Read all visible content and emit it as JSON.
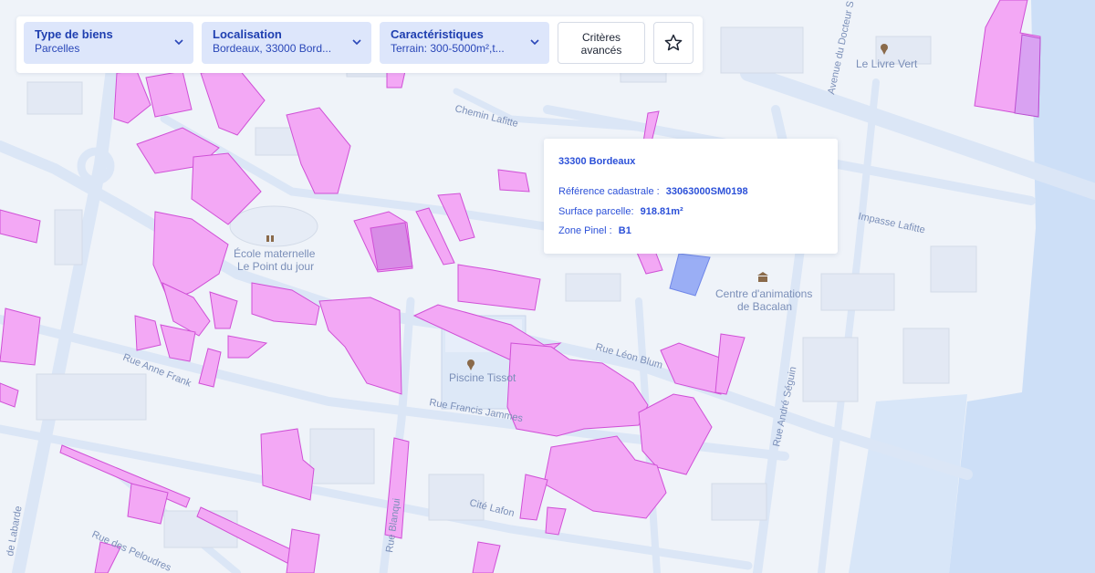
{
  "toolbar": {
    "filters": [
      {
        "title": "Type de biens",
        "value": "Parcelles"
      },
      {
        "title": "Localisation",
        "value": "Bordeaux, 33000 Bord..."
      },
      {
        "title": "Caractéristiques",
        "value": "Terrain: 300-5000m²,t..."
      }
    ],
    "advanced_label_line1": "Critères",
    "advanced_label_line2": "avancés"
  },
  "popup": {
    "title": "33300 Bordeaux",
    "ref_label": "Référence cadastrale :",
    "ref_value": "33063000SM0198",
    "surface_label": "Surface parcelle:",
    "surface_value": "918.81m²",
    "zone_label": "Zone Pinel :",
    "zone_value": "B1"
  },
  "map": {
    "places": [
      {
        "name": "École maternelle",
        "icon": "school-icon"
      },
      {
        "name": "Le Point du jour"
      },
      {
        "name": "Piscine Tissot",
        "icon": "pool-pin-icon"
      },
      {
        "name": "Centre d'animations",
        "icon": "museum-icon"
      },
      {
        "name": "de Bacalan"
      },
      {
        "name": "Le Livre Vert",
        "icon": "shop-pin-icon"
      }
    ],
    "streets": [
      "Chemin Lafitte",
      "Impasse Lafitte",
      "Rue Léon Blum",
      "Rue Anne Frank",
      "Rue Francis Jammes",
      "Rue André Séguin",
      "Cité Lafon",
      "Rue des Peloudres",
      "Avenue du Docteur S",
      "Rue Blanqui",
      "de Labarde"
    ],
    "colors": {
      "parcel_fill": "#f3a8f5",
      "parcel_stroke": "#cf50d6",
      "selected_fill": "#9aaef5",
      "water": "#cddff7",
      "road": "#dfe9f7"
    }
  }
}
